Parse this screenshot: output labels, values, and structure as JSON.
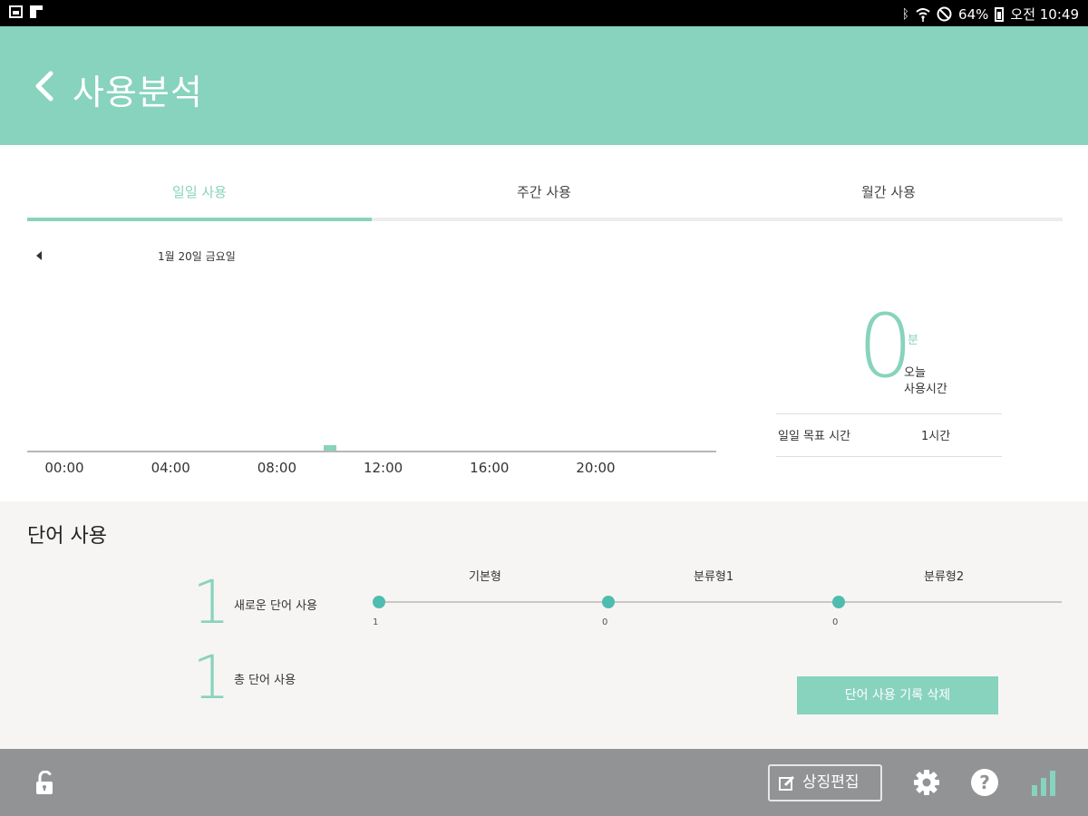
{
  "status_bar": {
    "battery": "64%",
    "time": "오전 10:49"
  },
  "header": {
    "title": "사용분석"
  },
  "tabs": [
    {
      "label": "일일 사용",
      "active": true
    },
    {
      "label": "주간 사용",
      "active": false
    },
    {
      "label": "월간 사용",
      "active": false
    }
  ],
  "date_nav": {
    "date": "1월 20일 금요일"
  },
  "chart_data": {
    "type": "bar",
    "x_ticks": [
      "00:00",
      "04:00",
      "08:00",
      "12:00",
      "16:00",
      "20:00"
    ],
    "x_range_hours": [
      0,
      26
    ],
    "bars": [
      {
        "hour": 10,
        "value": 0.04
      }
    ],
    "title": "",
    "xlabel": "",
    "ylabel": ""
  },
  "today": {
    "value": "0",
    "unit": "분",
    "label_line1": "오늘",
    "label_line2": "사용시간",
    "goal_label": "일일 목표 시간",
    "goal_value": "1시간"
  },
  "words": {
    "title": "단어 사용",
    "new_count": "1",
    "new_label": "새로운 단어 사용",
    "total_count": "1",
    "total_label": "총 단어 사용",
    "categories": [
      {
        "label": "기본형",
        "value": "1"
      },
      {
        "label": "분류형1",
        "value": "0"
      },
      {
        "label": "분류형2",
        "value": "0"
      }
    ],
    "delete_button": "단어 사용 기록 삭제"
  },
  "bottom_bar": {
    "edit_button": "상징편집",
    "help_glyph": "?"
  },
  "colors": {
    "accent": "#88d3bd",
    "dot": "#4fbcb0",
    "bottom_bar": "#929395"
  }
}
